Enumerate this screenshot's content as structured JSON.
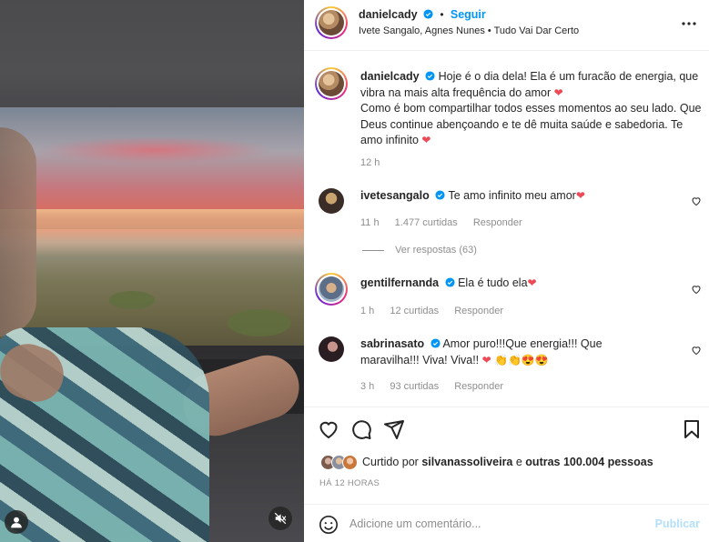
{
  "post": {
    "author": "danielcady",
    "follow_label": "Seguir",
    "dot": "•",
    "subline": "Ivete Sangalo, Agnes Nunes • Tudo Vai Dar Certo"
  },
  "caption": {
    "author": "danielcady",
    "text_1": "Hoje é o dia dela! Ela é um furacão de energia, que vibra na mais alta frequência do amor",
    "heart_1": "❤",
    "text_2": "Como é bom compartilhar todos esses momentos ao seu lado. Que Deus continue abençoando e te dê muita saúde e sabedoria. Te amo infinito",
    "heart_2": "❤",
    "time": "12 h"
  },
  "comments": [
    {
      "user": "ivetesangalo",
      "text": "Te amo infinito meu amor",
      "emoji": "❤",
      "time": "11 h",
      "likes": "1.477 curtidas",
      "reply": "Responder"
    },
    {
      "user": "gentilfernanda",
      "text": "Ela é tudo ela",
      "emoji": "❤",
      "time": "1 h",
      "likes": "12 curtidas",
      "reply": "Responder"
    },
    {
      "user": "sabrinasato",
      "text": "Amor puro!!!Que energia!!! Que maravilha!!! Viva! Viva!!",
      "emoji": "❤ 👏👏😍😍",
      "time": "3 h",
      "likes": "93 curtidas",
      "reply": "Responder"
    }
  ],
  "view_replies": "Ver respostas (63)",
  "likes": {
    "prefix": "Curtido por ",
    "user": "silvanassoliveira",
    "middle": " e ",
    "others": "outras 100.004 pessoas"
  },
  "time_ago": "HÁ 12 HORAS",
  "add_comment": {
    "placeholder": "Adicione um comentário...",
    "publish": "Publicar"
  },
  "icons": [
    "more-icon",
    "heart-icon",
    "comment-icon",
    "share-icon",
    "bookmark-icon",
    "emoji-icon",
    "mute-icon",
    "user-tag-icon",
    "verified-icon"
  ],
  "colors": {
    "link": "#0095f6",
    "heart": "#ed4956",
    "muted": "#8e8e8e",
    "publish_disabled": "#b2dffc"
  }
}
